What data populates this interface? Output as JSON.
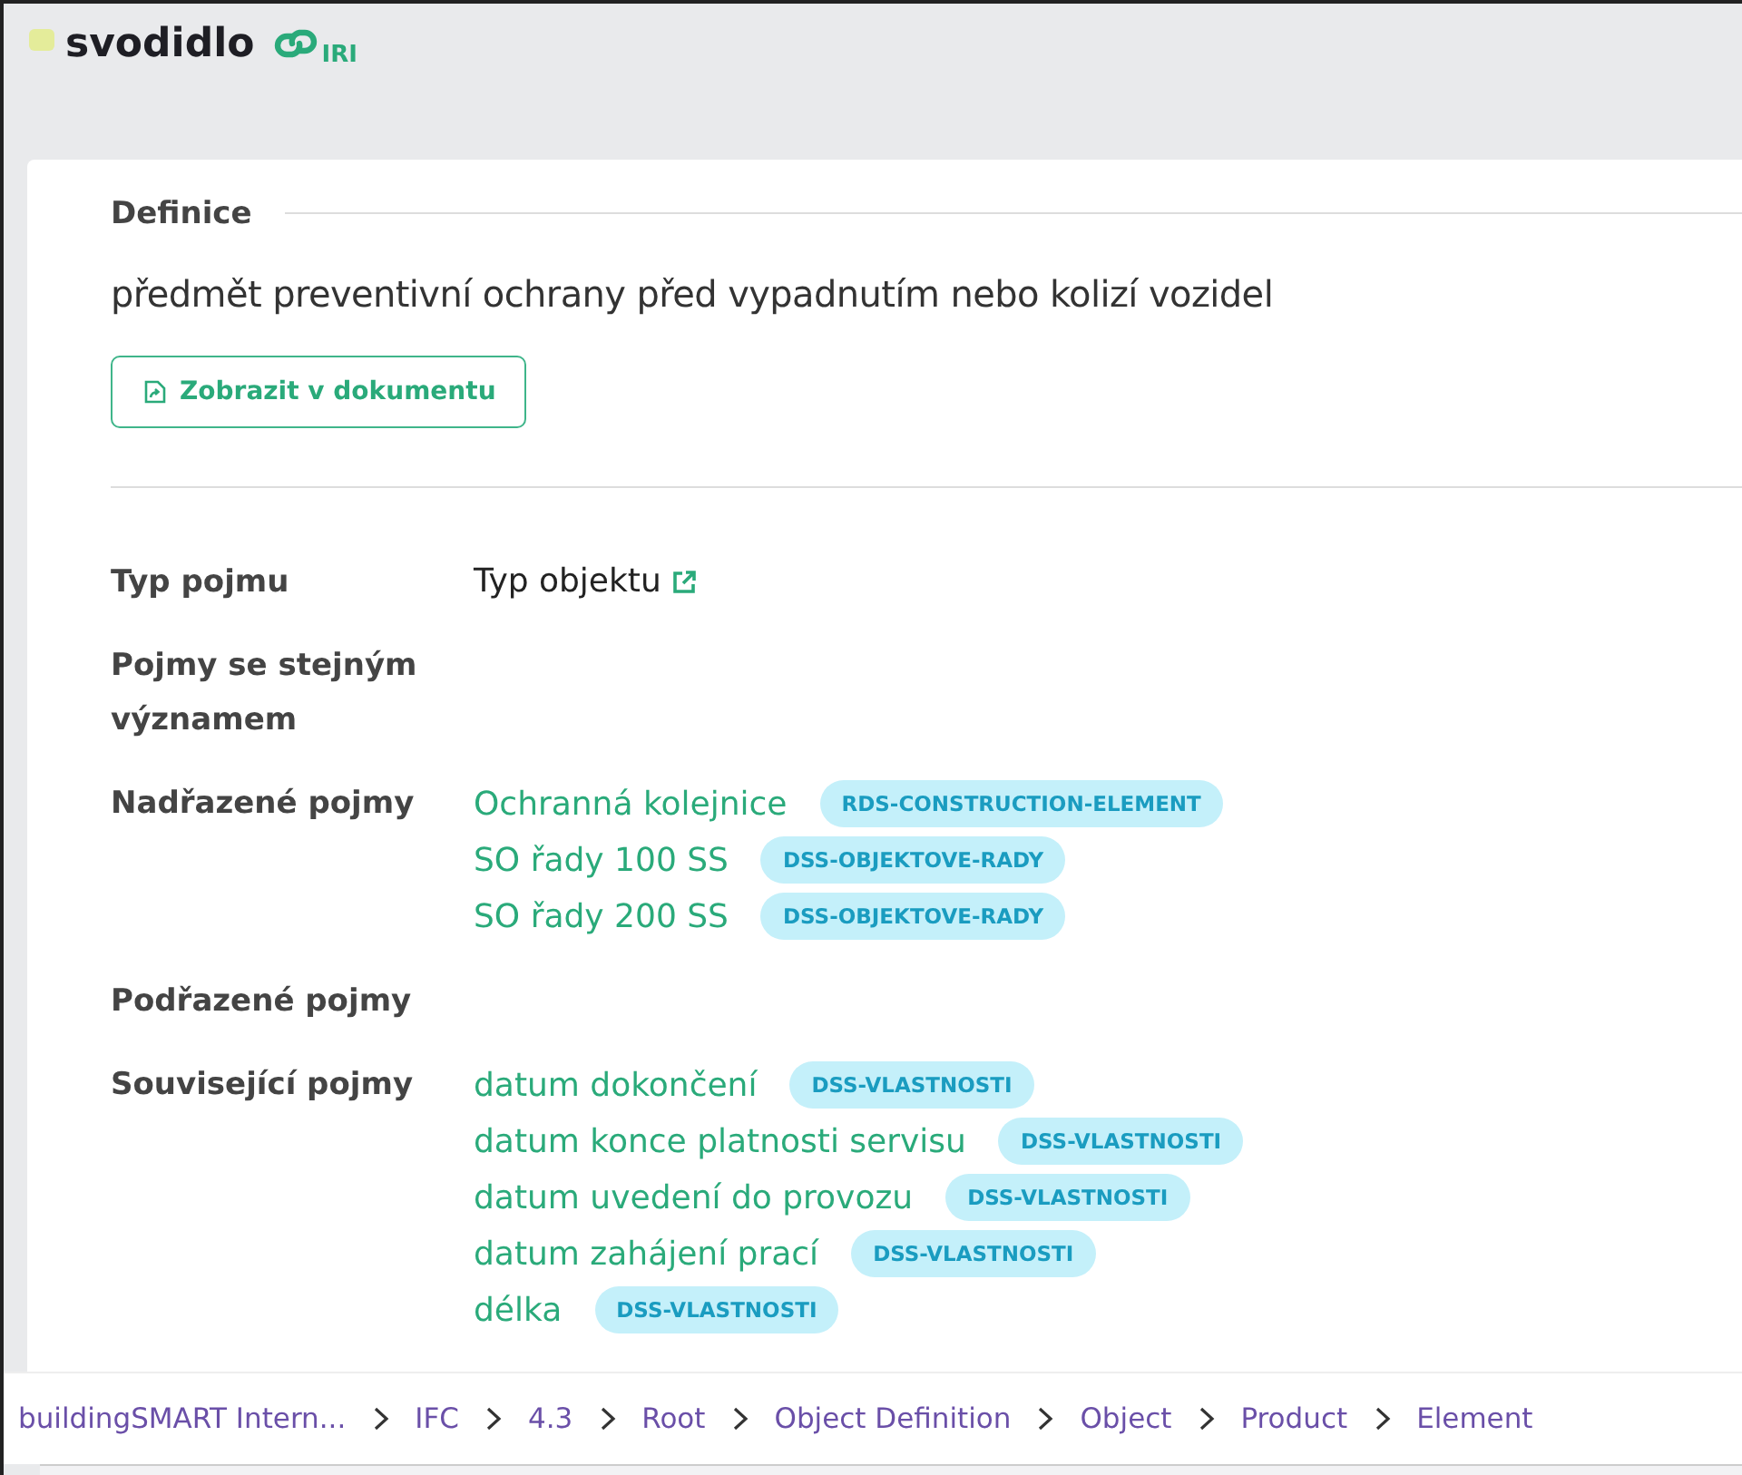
{
  "title": "svodidlo",
  "iri_label": "IRI",
  "definition": {
    "heading": "Definice",
    "text": "předmět preventivní ochrany před vypadnutím nebo kolizí vozidel",
    "button": "Zobrazit v dokumentu"
  },
  "properties": [
    {
      "label": "Typ pojmu",
      "kind": "type",
      "value": "Typ objektu"
    },
    {
      "label": "Pojmy se stejným významem",
      "kind": "links"
    },
    {
      "label": "Nadřazené pojmy",
      "kind": "links",
      "items": [
        {
          "name": "Ochranná kolejnice",
          "tag": "RDS-CONSTRUCTION-ELEMENT"
        },
        {
          "name": "SO řady 100 SS",
          "tag": "DSS-OBJEKTOVE-RADY"
        },
        {
          "name": "SO řady 200 SS",
          "tag": "DSS-OBJEKTOVE-RADY"
        }
      ]
    },
    {
      "label": "Podřazené pojmy",
      "kind": "links"
    },
    {
      "label": "Související pojmy",
      "kind": "links",
      "items": [
        {
          "name": "datum dokončení",
          "tag": "DSS-VLASTNOSTI"
        },
        {
          "name": "datum konce platnosti servisu",
          "tag": "DSS-VLASTNOSTI"
        },
        {
          "name": "datum uvedení do provozu",
          "tag": "DSS-VLASTNOSTI"
        },
        {
          "name": "datum zahájení prací",
          "tag": "DSS-VLASTNOSTI"
        },
        {
          "name": "délka",
          "tag": "DSS-VLASTNOSTI"
        }
      ]
    }
  ],
  "breadcrumb": [
    "buildingSMART Intern...",
    "IFC",
    "4.3",
    "Root",
    "Object Definition",
    "Object",
    "Product",
    "Element"
  ]
}
